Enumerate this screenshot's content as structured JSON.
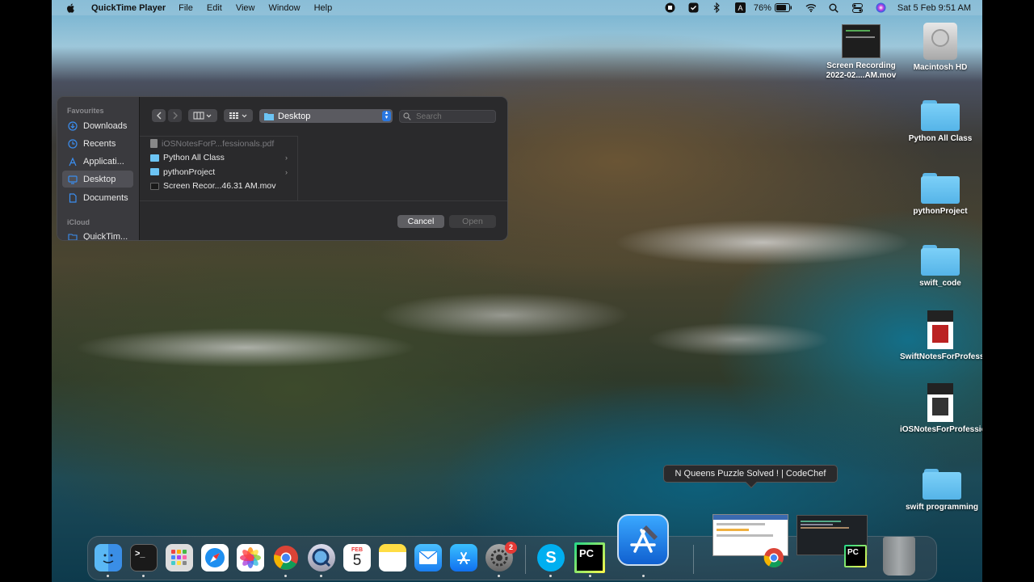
{
  "menubar": {
    "app_name": "QuickTime Player",
    "menus": [
      "File",
      "Edit",
      "View",
      "Window",
      "Help"
    ],
    "battery": "76%",
    "clock": "Sat 5 Feb  9:51 AM"
  },
  "desktop_icons": [
    {
      "label": "Screen Recording 2022-02....AM.mov",
      "icon": "video-thumbnail"
    },
    {
      "label": "Macintosh HD",
      "icon": "hard-drive-icon"
    },
    {
      "label": "Python All Class",
      "icon": "folder-icon"
    },
    {
      "label": "pythonProject",
      "icon": "folder-icon"
    },
    {
      "label": "swift_code",
      "icon": "folder-icon"
    },
    {
      "label": "SwiftNotesForProfessionals.pdf",
      "icon": "pdf-icon"
    },
    {
      "label": "iOSNotesForProfessionals.pdf",
      "icon": "pdf-icon"
    },
    {
      "label": "swift programming",
      "icon": "folder-icon"
    }
  ],
  "dialog": {
    "sidebar": {
      "favourites_heading": "Favourites",
      "items": [
        "Downloads",
        "Recents",
        "Applicati...",
        "Desktop",
        "Documents"
      ],
      "icloud_heading": "iCloud",
      "icloud_items": [
        "QuickTim..."
      ]
    },
    "location": "Desktop",
    "search_placeholder": "Search",
    "files": [
      {
        "name": "iOSNotesForP...fessionals.pdf",
        "type": "pdf",
        "enabled": false
      },
      {
        "name": "Python All Class",
        "type": "folder",
        "enabled": true
      },
      {
        "name": "pythonProject",
        "type": "folder",
        "enabled": true
      },
      {
        "name": "Screen Recor...46.31 AM.mov",
        "type": "video",
        "enabled": true
      }
    ],
    "cancel_label": "Cancel",
    "open_label": "Open"
  },
  "tooltip": "N Queens Puzzle Solved ! | CodeChef",
  "dock": {
    "apps": [
      "Finder",
      "Terminal",
      "Launchpad",
      "Safari",
      "Photos",
      "Chrome",
      "QuickTime Player",
      "Calendar",
      "Notes",
      "Mail",
      "App Store",
      "System Preferences",
      "Skype",
      "PyCharm",
      "Xcode"
    ],
    "calendar_month": "FEB",
    "calendar_day": "5",
    "settings_badge": "2",
    "pycharm_label": "PC"
  },
  "colors": {
    "accent": "#2a78e0",
    "folder": "#6cc4f4"
  }
}
